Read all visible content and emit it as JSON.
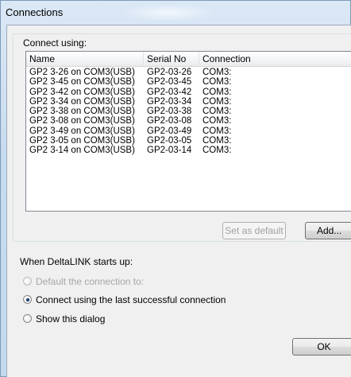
{
  "window": {
    "title": "Connections"
  },
  "connect_group": {
    "label": "Connect using:"
  },
  "list": {
    "columns": [
      "Name",
      "Serial No",
      "Connection"
    ],
    "rows": [
      {
        "name": "GP2 3-26 on COM3(USB)",
        "serial": "GP2-03-26",
        "connection": "COM3:"
      },
      {
        "name": "GP2 3-45 on COM3(USB)",
        "serial": "GP2-03-45",
        "connection": "COM3:"
      },
      {
        "name": "GP2 3-42 on COM3(USB)",
        "serial": "GP2-03-42",
        "connection": "COM3:"
      },
      {
        "name": "GP2 3-34 on COM3(USB)",
        "serial": "GP2-03-34",
        "connection": "COM3:"
      },
      {
        "name": "GP2 3-38 on COM3(USB)",
        "serial": "GP2-03-38",
        "connection": "COM3:"
      },
      {
        "name": "GP2 3-08 on COM3(USB)",
        "serial": "GP2-03-08",
        "connection": "COM3:"
      },
      {
        "name": "GP2 3-49 on COM3(USB)",
        "serial": "GP2-03-49",
        "connection": "COM3:"
      },
      {
        "name": "GP2 3-05 on COM3(USB)",
        "serial": "GP2-03-05",
        "connection": "COM3:"
      },
      {
        "name": "GP2 3-14 on COM3(USB)",
        "serial": "GP2-03-14",
        "connection": "COM3:"
      }
    ]
  },
  "buttons": {
    "set_default": "Set as default",
    "add": "Add...",
    "ok": "OK"
  },
  "startup": {
    "label": "When DeltaLINK starts up:",
    "options": [
      {
        "label": "Default the connection to:",
        "checked": false,
        "enabled": false
      },
      {
        "label": "Connect using the last successful connection",
        "checked": true,
        "enabled": true
      },
      {
        "label": "Show this dialog",
        "checked": false,
        "enabled": true
      }
    ]
  }
}
